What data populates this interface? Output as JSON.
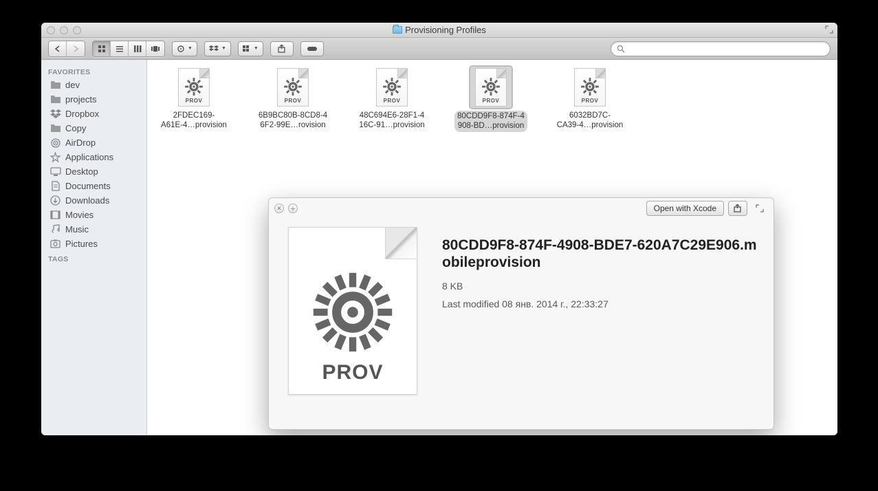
{
  "window": {
    "title": "Provisioning Profiles"
  },
  "toolbar": {
    "search_placeholder": ""
  },
  "sidebar": {
    "favorites_header": "FAVORITES",
    "tags_header": "TAGS",
    "items": [
      {
        "label": "dev",
        "icon": "folder"
      },
      {
        "label": "projects",
        "icon": "folder"
      },
      {
        "label": "Dropbox",
        "icon": "dropbox"
      },
      {
        "label": "Copy",
        "icon": "folder"
      },
      {
        "label": "AirDrop",
        "icon": "airdrop"
      },
      {
        "label": "Applications",
        "icon": "applications"
      },
      {
        "label": "Desktop",
        "icon": "desktop"
      },
      {
        "label": "Documents",
        "icon": "documents"
      },
      {
        "label": "Downloads",
        "icon": "downloads"
      },
      {
        "label": "Movies",
        "icon": "movies"
      },
      {
        "label": "Music",
        "icon": "music"
      },
      {
        "label": "Pictures",
        "icon": "pictures"
      }
    ]
  },
  "files": [
    {
      "line1": "2FDEC169-",
      "line2": "A61E-4…provision",
      "selected": false
    },
    {
      "line1": "6B9BC80B-8CD8-4",
      "line2": "6F2-99E…rovision",
      "selected": false
    },
    {
      "line1": "48C694E6-28F1-4",
      "line2": "16C-91…provision",
      "selected": false
    },
    {
      "line1": "80CDD9F8-874F-4",
      "line2": "908-BD…provision",
      "selected": true
    },
    {
      "line1": "6032BD7C-",
      "line2": "CA39-4…provision",
      "selected": false
    }
  ],
  "prov_small_label": "PROV",
  "prov_big_label": "PROV",
  "quicklook": {
    "open_button": "Open with Xcode",
    "filename": "80CDD9F8-874F-4908-BDE7-620A7C29E906.mobileprovision",
    "size": "8 KB",
    "modified": "Last modified 08 янв. 2014 г., 22:33:27"
  }
}
